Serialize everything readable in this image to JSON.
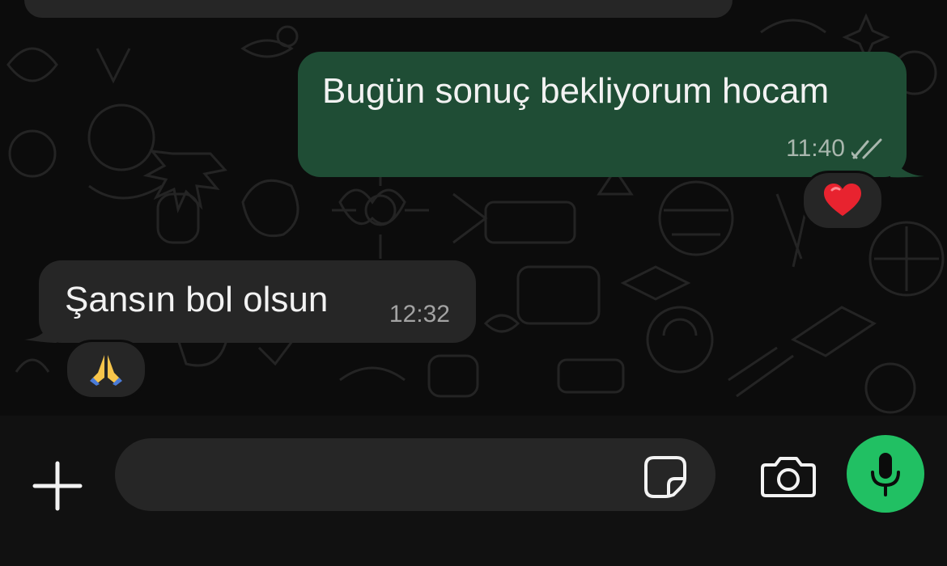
{
  "chat": {
    "messages": [
      {
        "direction": "outgoing",
        "text": "Bugün sonuç bekliyorum hocam",
        "time": "11:40",
        "status_icon": "double-check-icon",
        "reaction": "❤️"
      },
      {
        "direction": "incoming",
        "text": "Şansın bol olsun",
        "time": "12:32",
        "reaction": "🙏"
      }
    ]
  },
  "composer": {
    "placeholder": "",
    "value": "",
    "icons": {
      "add": "plus-icon",
      "sticker": "sticker-icon",
      "camera": "camera-icon",
      "mic": "microphone-icon"
    }
  },
  "colors": {
    "outgoing_bubble": "#1f4d35",
    "incoming_bubble": "#262626",
    "mic_button": "#21c063",
    "background": "#0c0c0c"
  }
}
